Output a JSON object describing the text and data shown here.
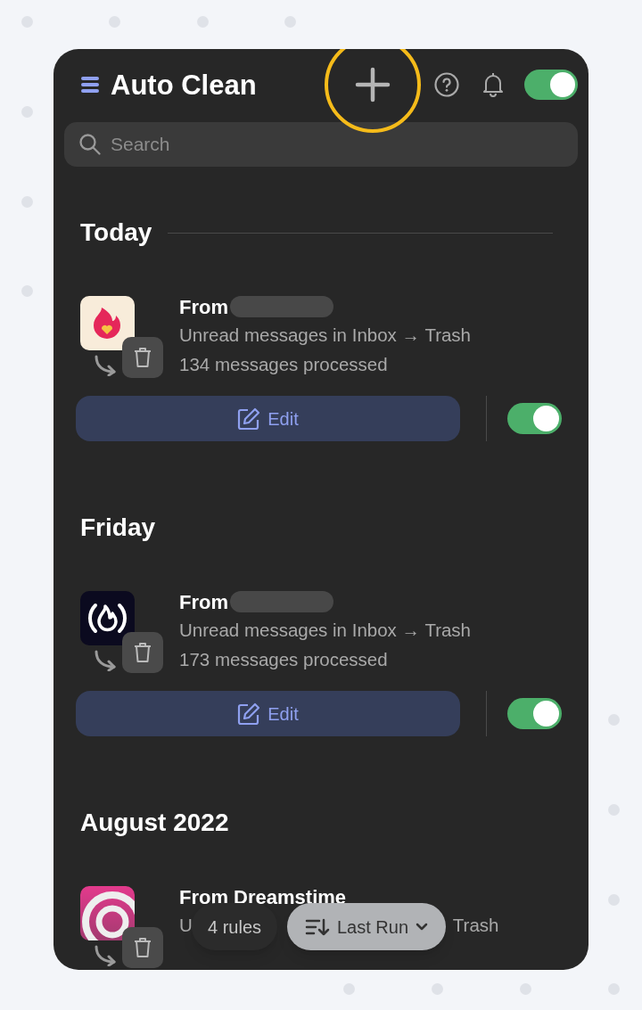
{
  "header": {
    "title": "Auto Clean",
    "add_button": {
      "highlighted": true
    },
    "master_switch": {
      "on": true
    }
  },
  "search": {
    "placeholder": "Search"
  },
  "sections": [
    {
      "heading": "Today",
      "divider": true,
      "rules": [
        {
          "kind": "flame-heart",
          "title": "From",
          "name_hidden": true,
          "lines": [
            [
              "Unread messages in Inbox → Trash"
            ],
            [
              "134 messages processed"
            ]
          ],
          "edit_label": "Edit",
          "enabled": true
        }
      ]
    },
    {
      "heading": "Friday",
      "divider": false,
      "rules": [
        {
          "kind": "flame-brackets",
          "title": "From",
          "name_hidden": true,
          "lines": [
            [
              "Unread messages in Inbox → Trash"
            ],
            [
              "173 messages processed"
            ]
          ],
          "edit_label": "Edit",
          "enabled": true
        }
      ]
    },
    {
      "heading": "August 2022",
      "divider": false,
      "rules": [
        {
          "kind": "spiral",
          "title": "From Dreamstime",
          "name_hidden": false,
          "lines": [
            [
              "U",
              "Trash"
            ]
          ]
        }
      ]
    }
  ],
  "footer": {
    "count": "4 rules",
    "sort": "Last Run"
  }
}
